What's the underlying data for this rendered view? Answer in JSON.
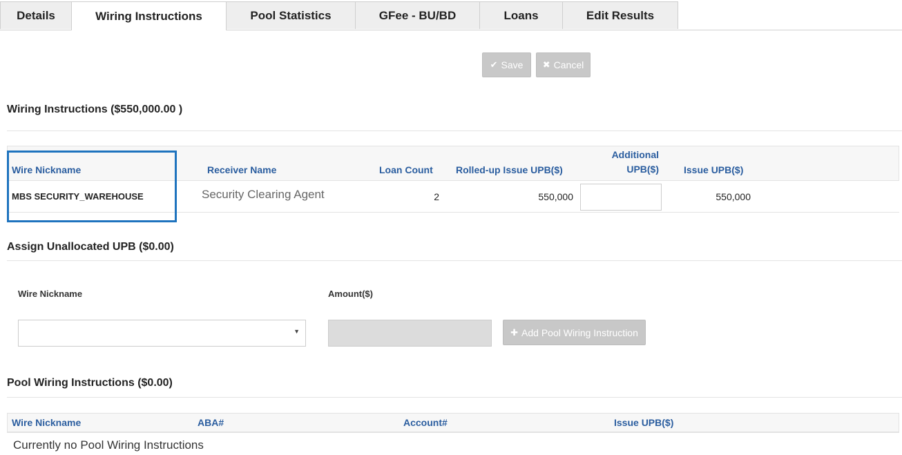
{
  "tabs": [
    {
      "label": "Details"
    },
    {
      "label": "Wiring Instructions"
    },
    {
      "label": "Pool Statistics"
    },
    {
      "label": "GFee - BU/BD"
    },
    {
      "label": "Loans"
    },
    {
      "label": "Edit Results"
    }
  ],
  "active_tab": "Wiring Instructions",
  "toolbar": {
    "save_label": "Save",
    "save_icon": "check-icon",
    "cancel_label": "Cancel",
    "cancel_icon": "x-icon"
  },
  "wiring": {
    "title": "Wiring Instructions ($550,000.00 )",
    "headers": {
      "wire_nickname": "Wire Nickname",
      "receiver_name": "Receiver Name",
      "loan_count": "Loan Count",
      "rolled_up": "Rolled-up Issue UPB($)",
      "additional_line1": "Additional",
      "additional_line2": "UPB($)",
      "issue_upb": "Issue UPB($)"
    },
    "row": {
      "wire_nickname": "MBS SECURITY_WAREHOUSE",
      "receiver_name": "Security Clearing Agent",
      "loan_count": "2",
      "rolled_up": "550,000",
      "additional": "",
      "issue_upb": "550,000"
    }
  },
  "assign": {
    "title": "Assign Unallocated UPB ($0.00)",
    "wire_nickname_label": "Wire Nickname",
    "amount_label": "Amount($)",
    "wire_nickname_value": "",
    "amount_value": "",
    "add_button_label": "Add Pool Wiring Instruction",
    "add_icon": "plus-icon"
  },
  "pool": {
    "title": "Pool Wiring Instructions ($0.00)",
    "headers": {
      "wire_nickname": "Wire Nickname",
      "aba": "ABA#",
      "account": "Account#",
      "issue_upb": "Issue UPB($)"
    },
    "empty_message": "Currently no Pool Wiring Instructions"
  },
  "colors": {
    "header_text": "#2a5d9f",
    "highlight_border": "#1e73be",
    "disabled_button": "#c8c8c8"
  }
}
